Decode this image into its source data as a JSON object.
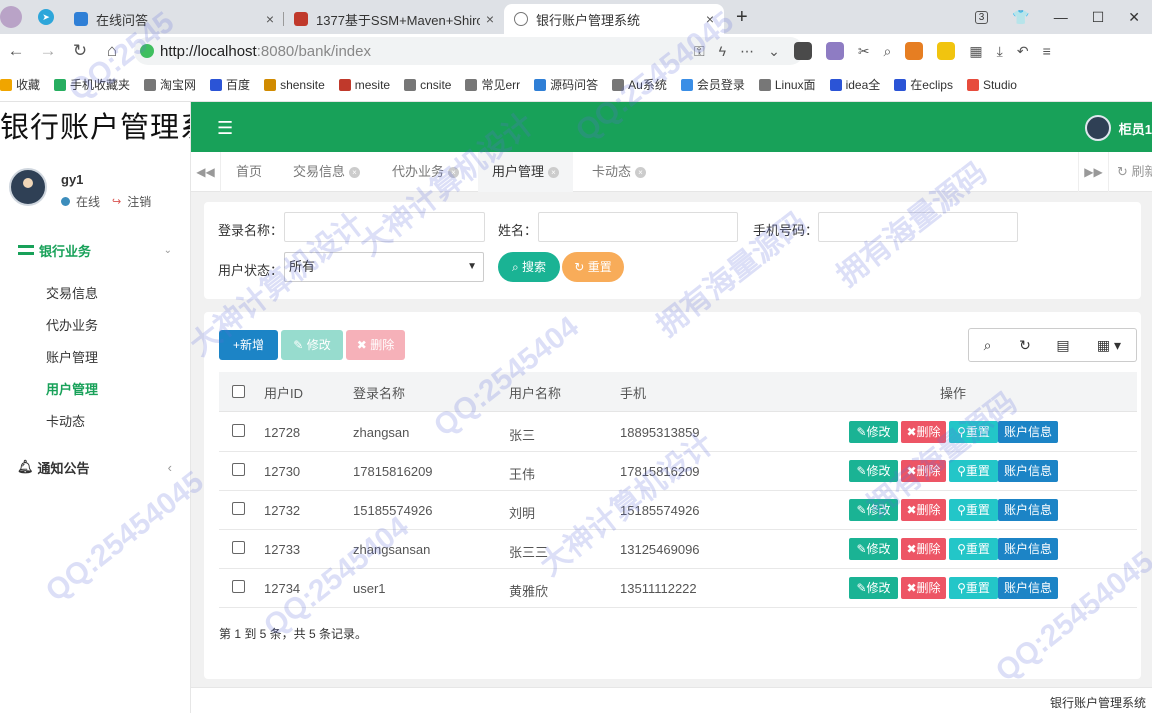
{
  "browser": {
    "tabs": [
      {
        "title": "在线问答",
        "close": "×",
        "favicon_color": "#2f7fd6"
      },
      {
        "title": "1377基于SSM+Maven+Shiro",
        "close": "×",
        "favicon_color": "#c0392b"
      },
      {
        "title": "银行账户管理系统",
        "close": "×",
        "favicon_color": "#777777"
      }
    ],
    "new_tab": "+",
    "window_controls": {
      "tab_count": "3",
      "minimize": "—",
      "maximize": "☐",
      "close": "✕"
    },
    "url": {
      "host": "http://localhost",
      "rest": ":8080/bank/index"
    },
    "bookmarks": [
      {
        "label": "收藏",
        "color": "#f0a500"
      },
      {
        "label": "手机收藏夹",
        "color": "#27ae60"
      },
      {
        "label": "淘宝网",
        "color": "#777777"
      },
      {
        "label": "百度",
        "color": "#2b54d6"
      },
      {
        "label": "shensite",
        "color": "#d18b00"
      },
      {
        "label": "mesite",
        "color": "#c0392b"
      },
      {
        "label": "cnsite",
        "color": "#777777"
      },
      {
        "label": "常见err",
        "color": "#777777"
      },
      {
        "label": "源码问答",
        "color": "#2f7fd6"
      },
      {
        "label": "Au系统",
        "color": "#777777"
      },
      {
        "label": "会员登录",
        "color": "#3a8ee6"
      },
      {
        "label": "Linux面",
        "color": "#777777"
      },
      {
        "label": "idea全",
        "color": "#2b54d6"
      },
      {
        "label": "在eclips",
        "color": "#2b54d6"
      },
      {
        "label": "Studio",
        "color": "#e74c3c"
      }
    ]
  },
  "sidebar": {
    "logo": "银行账户管理系统",
    "user": {
      "name": "gy1",
      "status": "在线",
      "logout": "注销"
    },
    "group": {
      "label": "银行业务",
      "items": [
        {
          "label": "交易信息"
        },
        {
          "label": "代办业务"
        },
        {
          "label": "账户管理"
        },
        {
          "label": "用户管理"
        },
        {
          "label": "卡动态"
        }
      ]
    },
    "notice": "通知公告"
  },
  "topbar": {
    "user": "柜员1"
  },
  "page_tabs": [
    {
      "label": "首页"
    },
    {
      "label": "交易信息"
    },
    {
      "label": "代办业务"
    },
    {
      "label": "用户管理"
    },
    {
      "label": "卡动态"
    }
  ],
  "page_tabs_refresh": "刷新",
  "search": {
    "login_label": "登录名称：",
    "name_label": "姓名：",
    "phone_label": "手机号码：",
    "status_label": "用户状态：",
    "status_value": "所有",
    "search_btn": "搜索",
    "reset_btn": "重置"
  },
  "toolbar": {
    "add": "+新增",
    "edit": "修改",
    "delete": "删除"
  },
  "table": {
    "columns": [
      "用户ID",
      "登录名称",
      "用户名称",
      "手机",
      "操作"
    ],
    "rows": [
      {
        "id": "12728",
        "login": "zhangsan",
        "name": "张三",
        "phone": "18895313859"
      },
      {
        "id": "12730",
        "login": "17815816209",
        "name": "王伟",
        "phone": "17815816209"
      },
      {
        "id": "12732",
        "login": "15185574926",
        "name": "刘明",
        "phone": "15185574926"
      },
      {
        "id": "12733",
        "login": "zhangsansan",
        "name": "张三三",
        "phone": "13125469096"
      },
      {
        "id": "12734",
        "login": "user1",
        "name": "黄雅欣",
        "phone": "13511112222"
      }
    ],
    "actions": {
      "edit": "修改",
      "delete": "删除",
      "reset": "重置",
      "account": "账户信息"
    },
    "summary": "第 1 到 5 条，共 5 条记录。"
  },
  "footer": "银行账户管理系统",
  "watermarks": [
    "QQ:2545",
    "QQ:25454045",
    "大神计算机设计",
    "拥有海量源码",
    "QQ:2545404",
    "QQ:25454045",
    "大神计算机设计",
    "拥有海量源码",
    "QQ:2545404",
    "拥有海量源码",
    "大神计算机设计",
    "QQ:25454045"
  ],
  "colors": {
    "brand_green": "#18a159",
    "primary": "#1c84c6",
    "success": "#1ab394",
    "warning": "#f8ac59",
    "danger": "#ed5565",
    "info": "#23c6c8"
  }
}
